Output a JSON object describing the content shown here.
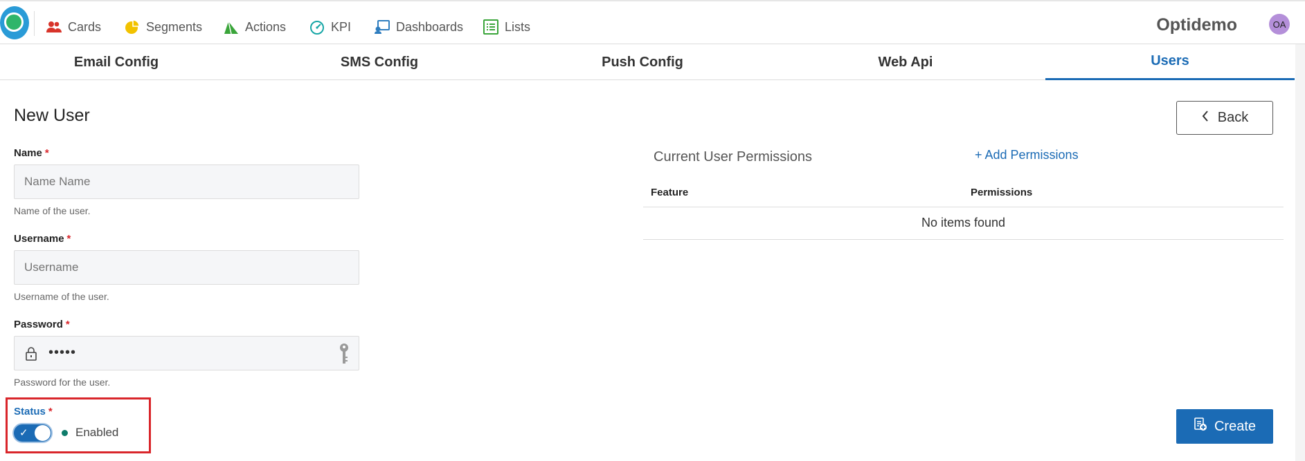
{
  "nav": {
    "items": [
      {
        "label": "Cards",
        "icon": "users-icon"
      },
      {
        "label": "Segments",
        "icon": "pie-chart-icon"
      },
      {
        "label": "Actions",
        "icon": "actions-icon"
      },
      {
        "label": "KPI",
        "icon": "gauge-icon"
      },
      {
        "label": "Dashboards",
        "icon": "dashboard-icon"
      },
      {
        "label": "Lists",
        "icon": "list-icon"
      }
    ],
    "brand": "Optidemo",
    "avatar": "OA"
  },
  "tabs": [
    {
      "label": "Email Config"
    },
    {
      "label": "SMS Config"
    },
    {
      "label": "Push Config"
    },
    {
      "label": "Web Api"
    },
    {
      "label": "Users",
      "active": true
    }
  ],
  "form": {
    "title": "New User",
    "name": {
      "label": "Name",
      "required": "*",
      "placeholder": "Name Name",
      "help": "Name of the user."
    },
    "username": {
      "label": "Username",
      "required": "*",
      "placeholder": "Username",
      "help": "Username of the user."
    },
    "password": {
      "label": "Password",
      "required": "*",
      "value": "•••••",
      "help": "Password for the user."
    },
    "status": {
      "label": "Status",
      "required": "*",
      "value": "Enabled",
      "enabled": true
    }
  },
  "permissions": {
    "back_label": "Back",
    "title": "Current User Permissions",
    "add_label": "+ Add Permissions",
    "columns": [
      "Feature",
      "Permissions"
    ],
    "empty_text": "No items found"
  },
  "create_label": "Create",
  "colors": {
    "accent": "#1b6bb5",
    "required": "#d9262b",
    "status_dot": "#0e7c6b",
    "highlight": "#d9262b"
  }
}
